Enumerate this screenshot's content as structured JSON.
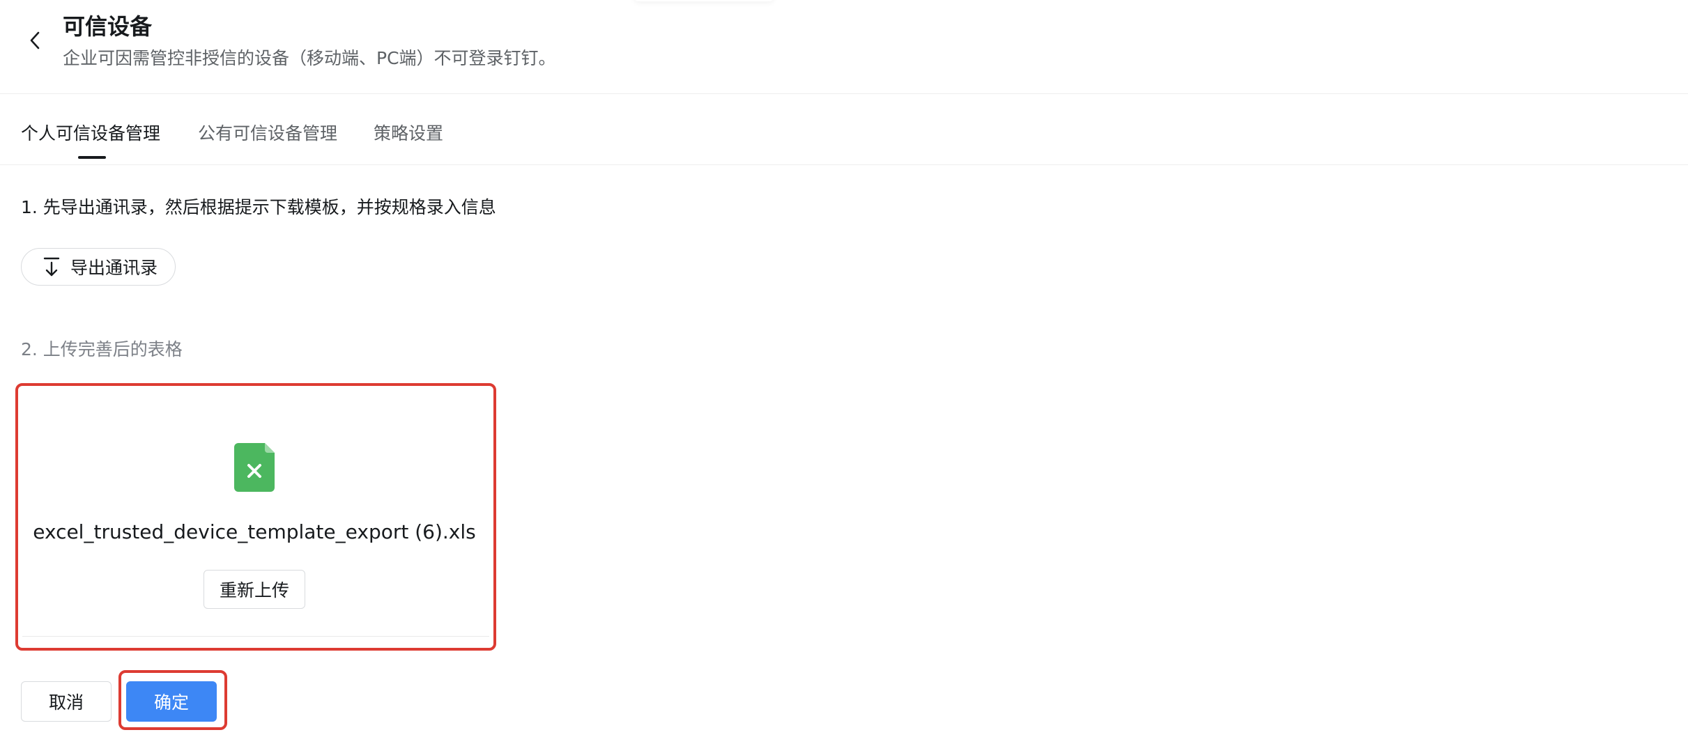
{
  "header": {
    "title": "可信设备",
    "subtitle": "企业可因需管控非授信的设备（移动端、PC端）不可登录钉钉。",
    "back_icon": "chevron-left-icon"
  },
  "tabs": [
    {
      "label": "个人可信设备管理",
      "active": true
    },
    {
      "label": "公有可信设备管理",
      "active": false
    },
    {
      "label": "策略设置",
      "active": false
    }
  ],
  "step1": {
    "text": "1. 先导出通讯录，然后根据提示下载模板，并按规格录入信息",
    "export_button_label": "导出通讯录",
    "export_icon": "download-icon"
  },
  "step2": {
    "text": "2. 上传完善后的表格"
  },
  "upload": {
    "file_icon": "excel-file-icon",
    "file_name": "excel_trusted_device_template_export (6).xls",
    "reupload_label": "重新上传"
  },
  "footer": {
    "cancel_label": "取消",
    "confirm_label": "确定"
  },
  "colors": {
    "primary": "#3d87f5",
    "highlight": "#dd3b32",
    "excel_green": "#4cb75f"
  }
}
